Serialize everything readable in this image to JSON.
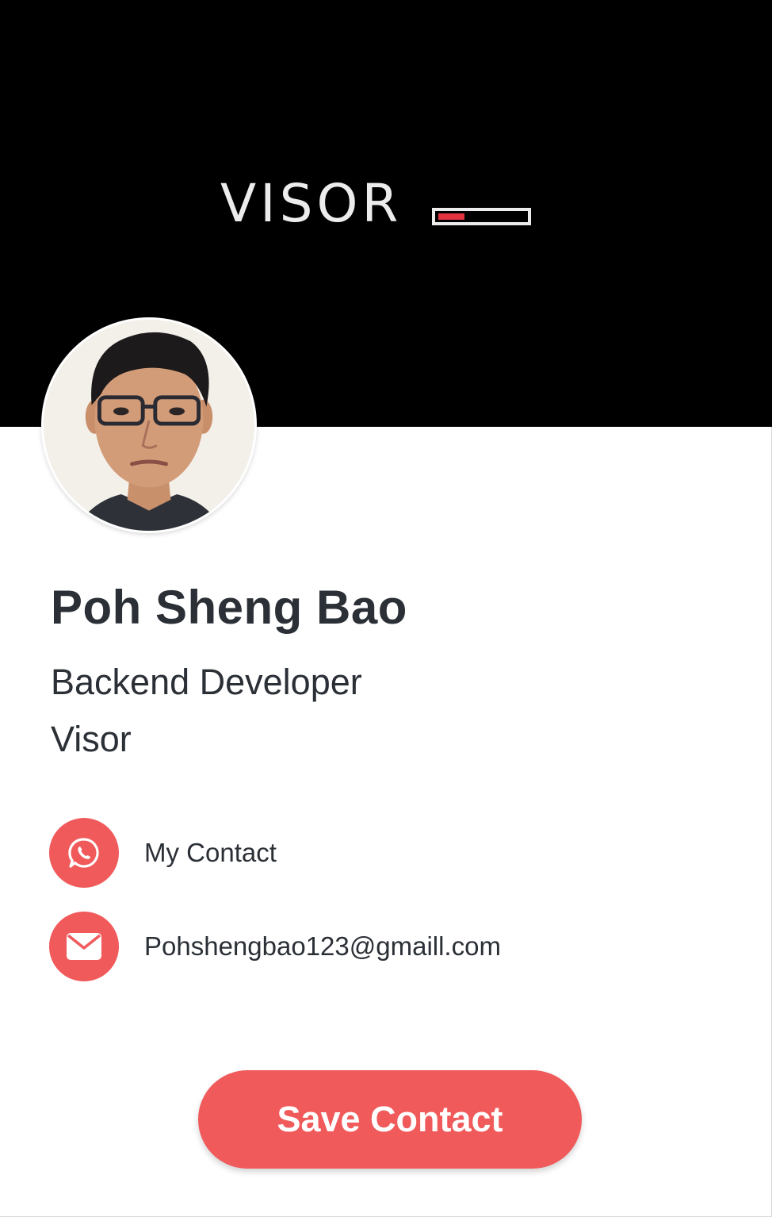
{
  "banner": {
    "logo_text": "VISOR",
    "background_color": "#000000",
    "logo_bar_accent_color": "#e2333f"
  },
  "profile": {
    "avatar_icon": "profile-photo",
    "name": "Poh Sheng Bao",
    "job_title": "Backend Developer",
    "company": "Visor"
  },
  "contacts": [
    {
      "icon": "whatsapp-icon",
      "label": "My Contact"
    },
    {
      "icon": "mail-icon",
      "label": "Pohshengbao123@gmaill.com"
    }
  ],
  "actions": {
    "save_label": "Save Contact"
  },
  "colors": {
    "accent": "#f05a5b",
    "text": "#2b2f36",
    "background": "#ffffff"
  }
}
